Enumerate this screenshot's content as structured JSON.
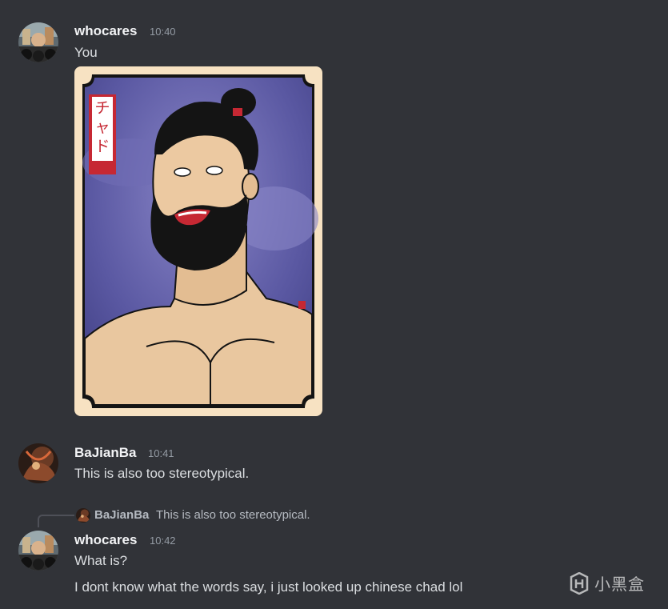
{
  "messages": [
    {
      "author": "whocares",
      "time": "10:40",
      "lines": [
        "You"
      ],
      "attachment": {
        "caption_vertical": "チャド",
        "colors": {
          "frame": "#f7e2c2",
          "sky": "#4f4f96",
          "skin": "#e9c79f",
          "hair": "#141414",
          "banner": "#c62833"
        }
      }
    },
    {
      "author": "BaJianBa",
      "time": "10:41",
      "lines": [
        "This is also too stereotypical."
      ]
    },
    {
      "reply_to": {
        "author": "BaJianBa",
        "text": "This is also too stereotypical."
      },
      "author": "whocares",
      "time": "10:42",
      "lines": [
        "What is?",
        "I dont know what the words say, i just looked up chinese chad lol"
      ]
    }
  ],
  "watermark": {
    "text": "小黑盒"
  },
  "colors": {
    "background": "#313338",
    "username": "#f2f3f5",
    "text": "#dbdee1",
    "timestamp": "#949ba4"
  }
}
